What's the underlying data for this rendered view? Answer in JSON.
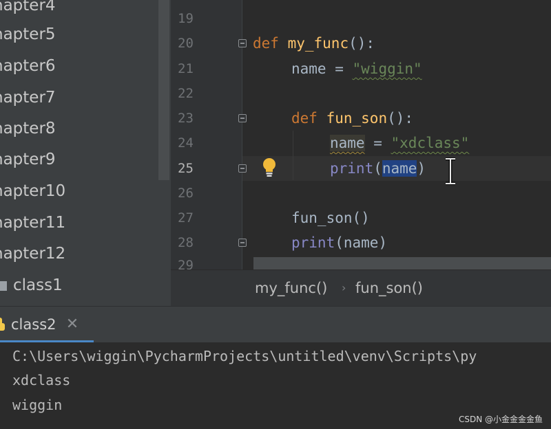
{
  "sidebar": {
    "items": [
      {
        "label": "napter4"
      },
      {
        "label": "napter5"
      },
      {
        "label": "napter6"
      },
      {
        "label": "napter7"
      },
      {
        "label": "napter8"
      },
      {
        "label": "napter9"
      },
      {
        "label": "napter10"
      },
      {
        "label": "napter11"
      },
      {
        "label": "napter12"
      },
      {
        "label": "class1"
      }
    ]
  },
  "editor": {
    "line_numbers": [
      "19",
      "20",
      "21",
      "22",
      "23",
      "24",
      "25",
      "26",
      "27",
      "28",
      "29"
    ],
    "current_line": "25",
    "code": {
      "l20": {
        "kw": "def",
        "name": "my_func",
        "rest": "():"
      },
      "l21": {
        "var": "name",
        "op": " = ",
        "str": "\"wiggin\""
      },
      "l23": {
        "kw": "def",
        "name": "fun_son",
        "rest": "():"
      },
      "l24": {
        "var": "name",
        "op": " = ",
        "str": "\"xdclass\""
      },
      "l25": {
        "fn": "print",
        "open": "(",
        "arg": "name",
        "close": ")"
      },
      "l27": {
        "call": "fun_son",
        "parens": "()"
      },
      "l28": {
        "fn": "print",
        "open": "(",
        "arg": "name",
        "close": ")"
      }
    }
  },
  "breadcrumbs": {
    "items": [
      "my_func()",
      "fun_son()"
    ],
    "separator": "›"
  },
  "run": {
    "tab_label": "class2",
    "close_glyph": "✕",
    "console_lines": [
      "C:\\Users\\wiggin\\PycharmProjects\\untitled\\venv\\Scripts\\py",
      "xdclass",
      "wiggin"
    ]
  },
  "watermark": "CSDN @小金金金金鱼",
  "colors": {
    "keyword": "#cc7832",
    "function": "#ffc66d",
    "string": "#6a8759",
    "builtin": "#8888c6",
    "selection": "#214283",
    "accent": "#4a88c7"
  }
}
